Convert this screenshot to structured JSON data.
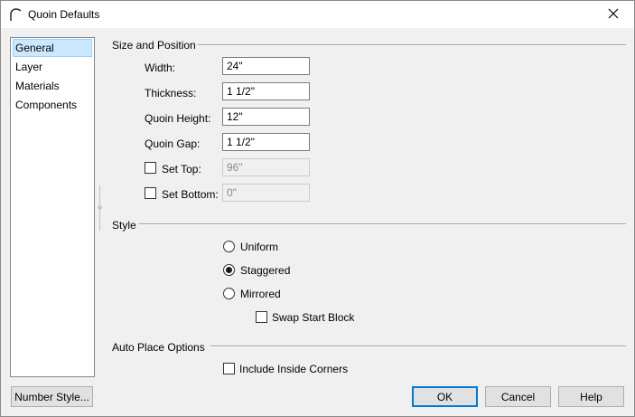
{
  "window": {
    "title": "Quoin Defaults"
  },
  "sidebar": {
    "items": [
      {
        "label": "General",
        "selected": true
      },
      {
        "label": "Layer"
      },
      {
        "label": "Materials"
      },
      {
        "label": "Components"
      }
    ]
  },
  "size_position": {
    "heading": "Size and Position",
    "width": {
      "label": "Width:",
      "value": "24\""
    },
    "thickness": {
      "label": "Thickness:",
      "value": "1 1/2\""
    },
    "quoin_height": {
      "label": "Quoin Height:",
      "value": "12\""
    },
    "quoin_gap": {
      "label": "Quoin Gap:",
      "value": "1 1/2\""
    },
    "set_top": {
      "label": "Set Top:",
      "value": "96\"",
      "checked": false
    },
    "set_bottom": {
      "label": "Set Bottom:",
      "value": "0\"",
      "checked": false
    }
  },
  "style": {
    "heading": "Style",
    "options": [
      {
        "label": "Uniform",
        "checked": false
      },
      {
        "label": "Staggered",
        "checked": true
      },
      {
        "label": "Mirrored",
        "checked": false
      }
    ],
    "swap_start_block": {
      "label": "Swap Start Block",
      "checked": false
    }
  },
  "auto_place": {
    "heading": "Auto Place Options",
    "include_inside_corners": {
      "label": "Include Inside Corners",
      "checked": false
    }
  },
  "buttons": {
    "number_style": "Number Style...",
    "ok": "OK",
    "cancel": "Cancel",
    "help": "Help"
  }
}
